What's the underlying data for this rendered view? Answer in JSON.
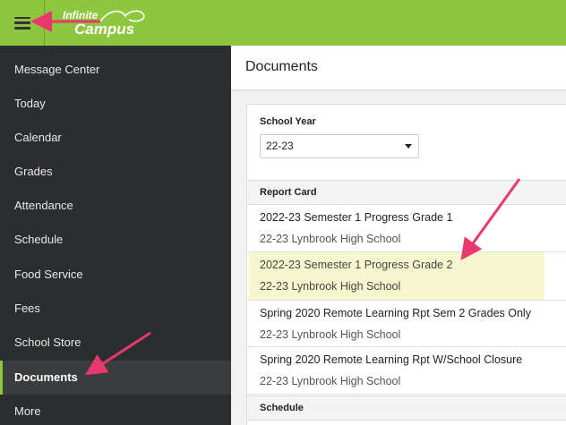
{
  "header": {
    "logo_line1": "Infinite",
    "logo_line2": "Campus",
    "brand_color": "#8dc63f",
    "menu_icon": "hamburger-icon"
  },
  "sidebar": {
    "items": [
      {
        "label": "Message Center"
      },
      {
        "label": "Today"
      },
      {
        "label": "Calendar"
      },
      {
        "label": "Grades"
      },
      {
        "label": "Attendance"
      },
      {
        "label": "Schedule"
      },
      {
        "label": "Food Service"
      },
      {
        "label": "Fees"
      },
      {
        "label": "School Store"
      },
      {
        "label": "Documents",
        "active": true
      },
      {
        "label": "More"
      }
    ]
  },
  "main": {
    "title": "Documents",
    "school_year_label": "School Year",
    "school_year_value": "22-23",
    "sections": [
      {
        "heading": "Report Card",
        "documents": [
          {
            "title": "2022-23 Semester 1 Progress Grade 1",
            "school": "22-23 Lynbrook High School"
          },
          {
            "title": "2022-23 Semester 1 Progress Grade 2",
            "school": "22-23 Lynbrook High School",
            "highlighted": true
          },
          {
            "title": "Spring 2020 Remote Learning Rpt Sem 2 Grades Only",
            "school": "22-23 Lynbrook High School"
          },
          {
            "title": "Spring 2020 Remote Learning Rpt W/School Closure",
            "school": "22-23 Lynbrook High School"
          }
        ]
      },
      {
        "heading": "Schedule",
        "documents": []
      }
    ]
  },
  "annotation_color": "#e8386d"
}
